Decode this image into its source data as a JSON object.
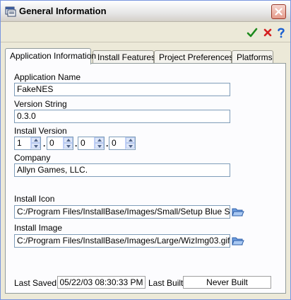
{
  "window": {
    "title": "General Information"
  },
  "toolbar": {
    "ok_icon": "checkmark-icon",
    "cancel_icon": "red-x-icon",
    "help_icon": "question-icon"
  },
  "tabs": [
    {
      "label": "Application Information",
      "active": true
    },
    {
      "label": "Install Features",
      "active": false
    },
    {
      "label": "Project Preferences",
      "active": false
    },
    {
      "label": "Platforms",
      "active": false
    }
  ],
  "form": {
    "app_name_label": "Application Name",
    "app_name_value": "FakeNES",
    "version_string_label": "Version String",
    "version_string_value": "0.3.0",
    "install_version_label": "Install Version",
    "install_version": [
      "1",
      "0",
      "0",
      "0"
    ],
    "dot": ".",
    "company_label": "Company",
    "company_value": "Allyn Games, LLC.",
    "install_icon_label": "Install Icon",
    "install_icon_value": "C:/Program Files/InstallBase/Images/Small/Setup Blue Screen.",
    "install_image_label": "Install Image",
    "install_image_value": "C:/Program Files/InstallBase/Images/Large/WizImg03.gif"
  },
  "status": {
    "last_saved_label": "Last Saved:",
    "last_saved_value": "05/22/03 08:30:33 PM",
    "last_built_label": "Last Built:",
    "last_built_value": "Never Built"
  },
  "colors": {
    "accent": "#1c8a1c",
    "cancel": "#d42020",
    "help": "#1a5fd0"
  }
}
